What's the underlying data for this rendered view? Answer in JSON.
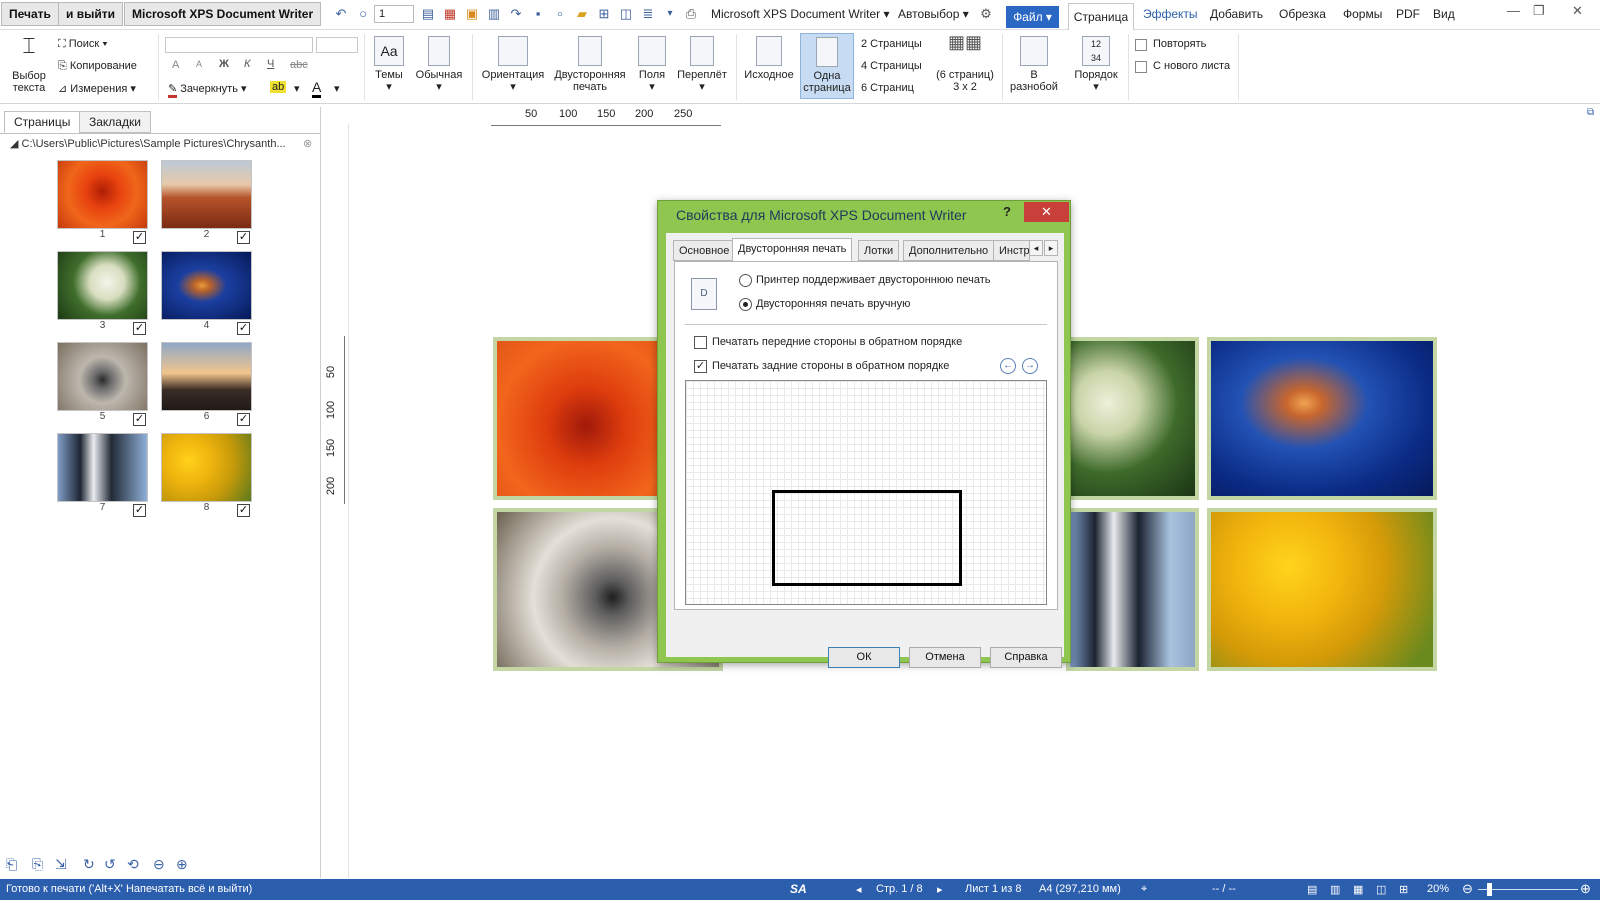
{
  "titlebar": {
    "print_label": "Печать",
    "print_exit_label": "и выйти",
    "printer_label": "Microsoft XPS Document Writer",
    "copies_value": "1",
    "printer_select": "Microsoft XPS Document Writer",
    "auto_select": "Автовыбор",
    "file_label": "Файл",
    "menu": [
      "Страница",
      "Эффекты",
      "Добавить",
      "Обрезка",
      "Формы",
      "PDF",
      "Вид"
    ]
  },
  "ribbon": {
    "select_text": "Выбор\nтекста",
    "search": "Поиск",
    "copy": "Копирование",
    "measure": "Измерения",
    "strike": "Зачеркнуть",
    "font_bold": "Ж",
    "font_italic": "К",
    "font_underline": "Ч",
    "font_strike": "abc",
    "font_grow": "A",
    "font_shrink": "A",
    "highlight": "ab",
    "font_color": "A",
    "themes": "Темы",
    "normal": "Обычная",
    "orientation": "Ориентация",
    "duplex": "Двусторонняя\nпечать",
    "margins": "Поля",
    "binding": "Переплёт",
    "original": "Исходное",
    "one_page": "Одна\nстраница",
    "two_pages": "2 Страницы",
    "four_pages": "4 Страницы",
    "six_pages": "6 Страниц",
    "six_grid": "(6 страниц)\n3 x 2",
    "scatter": "В\nразнобой",
    "order": "Порядок",
    "repeat": "Повторять",
    "new_sheet": "С нового листа"
  },
  "leftpanel": {
    "tabs": [
      "Страницы",
      "Закладки"
    ],
    "path": "C:\\Users\\Public\\Pictures\\Sample Pictures\\Chrysanth...",
    "thumbs": [
      "1",
      "2",
      "3",
      "4",
      "5",
      "6",
      "7",
      "8"
    ]
  },
  "ruler": {
    "h": [
      "50",
      "100",
      "150",
      "200",
      "250"
    ],
    "v": [
      "50",
      "100",
      "150",
      "200"
    ]
  },
  "dialog": {
    "title": "Свойства для Microsoft XPS Document Writer",
    "help": "?",
    "tabs": [
      "Основное",
      "Двусторонняя печать",
      "Лотки",
      "Дополнительно",
      "Инстр"
    ],
    "radio_printer": "Принтер поддерживает двустороннюю печать",
    "radio_manual": "Двусторонняя печать вручную",
    "check_front": "Печатать передние стороны в обратном порядке",
    "check_back": "Печатать задние стороны в обратном порядке",
    "ok": "ОК",
    "cancel": "Отмена",
    "help_btn": "Справка"
  },
  "status": {
    "ready": "Готово к печати ('Alt+X' Напечатать всё и выйти)",
    "sa": "SA",
    "page": "Стр. 1 / 8",
    "sheet": "Лист 1 из 8",
    "paper": "A4 (297,210 мм)",
    "pos": "-- / --",
    "zoom": "20%"
  }
}
